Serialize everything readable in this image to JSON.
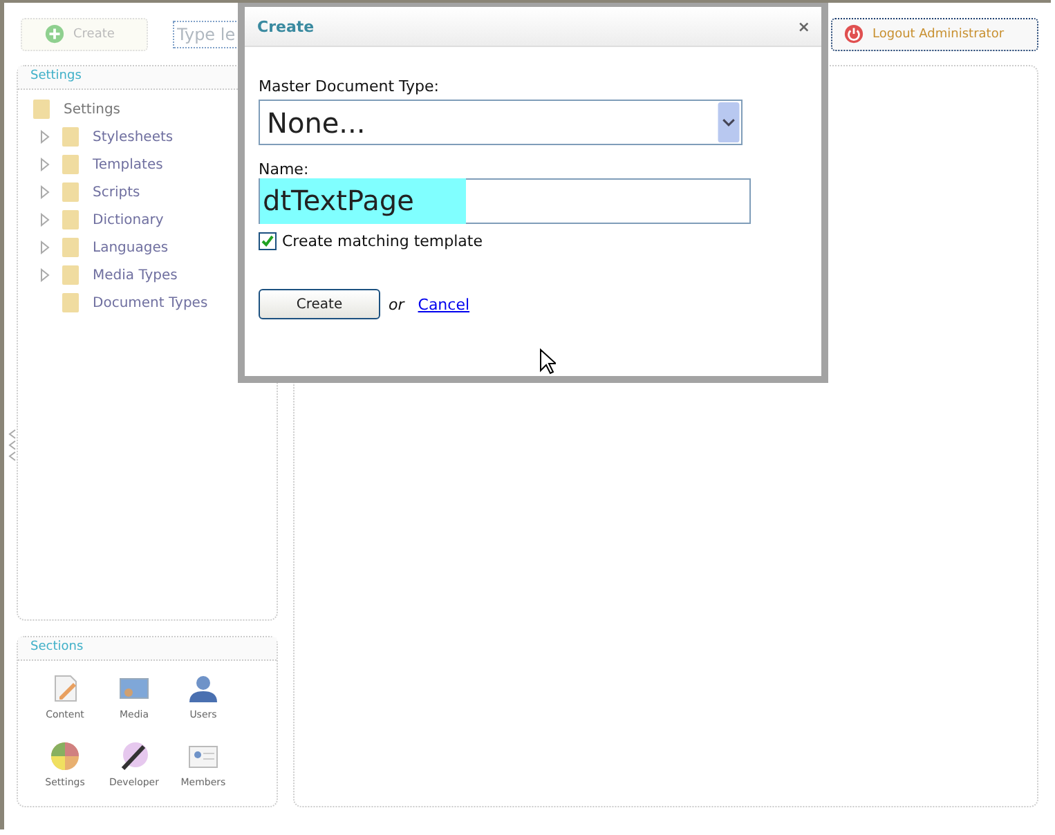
{
  "toolbar": {
    "create_button": "Create",
    "search": {
      "placeholder": "Type le"
    },
    "logout_button": "Logout Administrator"
  },
  "tree": {
    "title": "Settings",
    "root": {
      "label": "Settings",
      "children": [
        {
          "label": "Stylesheets",
          "expandable": true
        },
        {
          "label": "Templates",
          "expandable": true
        },
        {
          "label": "Scripts",
          "expandable": true
        },
        {
          "label": "Dictionary",
          "expandable": true
        },
        {
          "label": "Languages",
          "expandable": true
        },
        {
          "label": "Media Types",
          "expandable": true
        },
        {
          "label": "Document Types",
          "expandable": false
        }
      ]
    }
  },
  "sections": {
    "title": "Sections",
    "items": [
      {
        "label": "Content",
        "kind": "content"
      },
      {
        "label": "Media",
        "kind": "media"
      },
      {
        "label": "Users",
        "kind": "users"
      },
      {
        "label": "Settings",
        "kind": "settings"
      },
      {
        "label": "Developer",
        "kind": "developer"
      },
      {
        "label": "Members",
        "kind": "members"
      }
    ]
  },
  "dialog": {
    "title": "Create",
    "close": "×",
    "master_label": "Master Document Type:",
    "master_value": "None...",
    "name_label": "Name:",
    "name_value": "dtTextPage",
    "name_selected": true,
    "checkbox": {
      "label": "Create matching template",
      "checked": true
    },
    "create_button": "Create",
    "or": "or",
    "cancel_link": "Cancel"
  }
}
